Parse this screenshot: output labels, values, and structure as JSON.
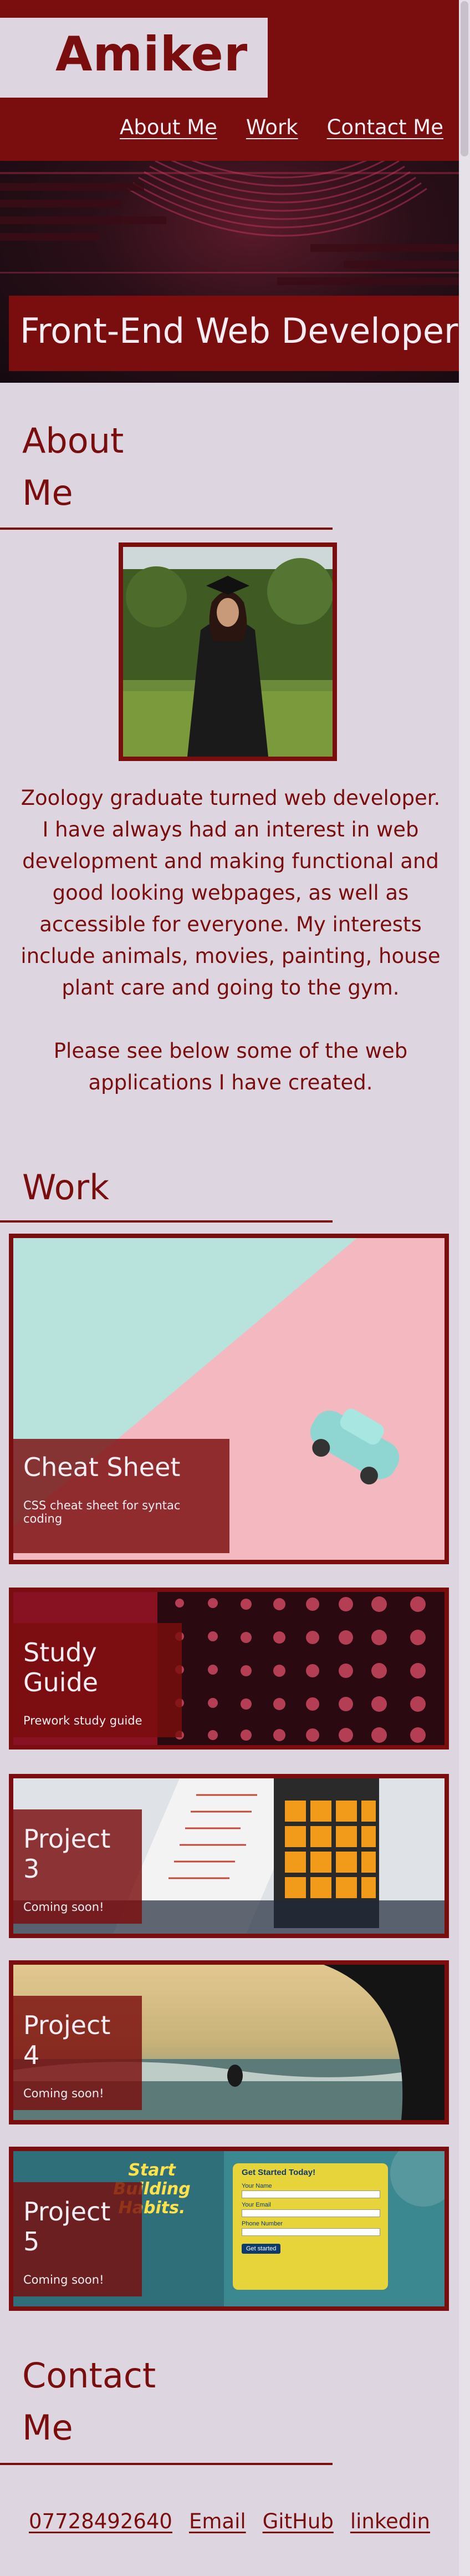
{
  "brand": {
    "name": "Amiker"
  },
  "nav": {
    "items": [
      "About Me",
      "Work",
      "Contact Me"
    ]
  },
  "hero": {
    "title": "Front-End Web Developer"
  },
  "about": {
    "heading": "About Me",
    "paragraph1": "Zoology graduate turned web developer. I have always had an interest in web development and making functional and good looking webpages, as well as accessible for everyone. My interests include animals, movies, painting, house plant care and going to the gym.",
    "paragraph2": "Please see below some of the web applications I have created."
  },
  "work": {
    "heading": "Work",
    "projects": [
      {
        "title": "Cheat Sheet",
        "subtitle": "CSS cheat sheet for syntac coding"
      },
      {
        "title": "Study Guide",
        "subtitle": "Prework study guide"
      },
      {
        "title": "Project 3",
        "subtitle": "Coming soon!"
      },
      {
        "title": "Project 4",
        "subtitle": "Coming soon!"
      },
      {
        "title": "Project 5",
        "subtitle": "Coming soon!"
      }
    ],
    "project5_preview": {
      "headline": "Start Building Habits.",
      "form_title": "Get Started Today!",
      "form_fields": [
        "Your Name",
        "Your Email",
        "Phone Number"
      ],
      "button": "Get started"
    }
  },
  "contact": {
    "heading": "Contact Me",
    "links": [
      "07728492640",
      "Email",
      "GitHub",
      "linkedin"
    ]
  },
  "colors": {
    "accent": "#7a0e0e",
    "background": "#ddd5df",
    "light_text": "#f4eef4"
  }
}
